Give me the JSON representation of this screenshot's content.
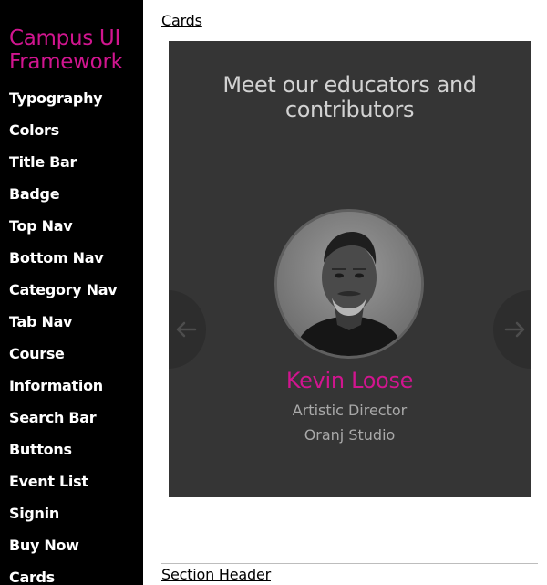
{
  "sidebar": {
    "title": "Campus UI Framework",
    "items": [
      {
        "label": "Typography"
      },
      {
        "label": "Colors"
      },
      {
        "label": "Title Bar"
      },
      {
        "label": "Badge"
      },
      {
        "label": "Top Nav"
      },
      {
        "label": "Bottom Nav"
      },
      {
        "label": "Category Nav"
      },
      {
        "label": "Tab Nav"
      },
      {
        "label": "Course"
      },
      {
        "label": "Information"
      },
      {
        "label": "Search Bar"
      },
      {
        "label": "Buttons"
      },
      {
        "label": "Event List"
      },
      {
        "label": "Signin"
      },
      {
        "label": "Buy Now"
      },
      {
        "label": "Cards"
      }
    ]
  },
  "main": {
    "section_link": "Cards",
    "next_section_link": "Section Header",
    "card": {
      "heading": "Meet our educators and contributors",
      "person": {
        "name": "Kevin Loose",
        "role": "Artistic Director",
        "organization": "Oranj Studio"
      },
      "prev_icon": "arrow-left-icon",
      "next_icon": "arrow-right-icon"
    }
  },
  "colors": {
    "accent": "#d1158f",
    "sidebar_bg": "#000000",
    "card_bg": "#353535"
  }
}
